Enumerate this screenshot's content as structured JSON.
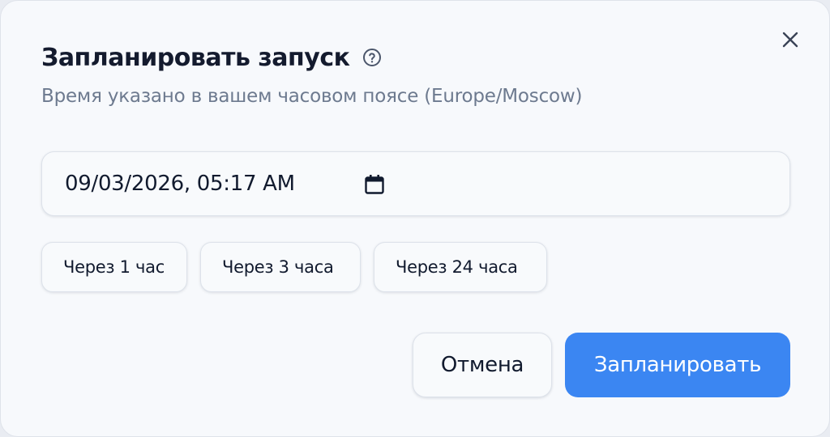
{
  "dialog": {
    "title": "Запланировать запуск",
    "subtitle": "Время указано в вашем часовом поясе (Europe/Moscow)",
    "help_icon": "help-circle-icon",
    "close_icon": "close-icon"
  },
  "datetime": {
    "value": "09/03/2026, 05:17 AM",
    "icon": "calendar-icon"
  },
  "quick_options": [
    {
      "label": "Через 1 час"
    },
    {
      "label": "Через 3 часа"
    },
    {
      "label": "Через 24 часа"
    }
  ],
  "actions": {
    "cancel_label": "Отмена",
    "submit_label": "Запланировать"
  },
  "colors": {
    "primary": "#3b86f2",
    "background": "#f7f9fc",
    "subtitle": "#6d7a8f",
    "text": "#111a2e"
  }
}
